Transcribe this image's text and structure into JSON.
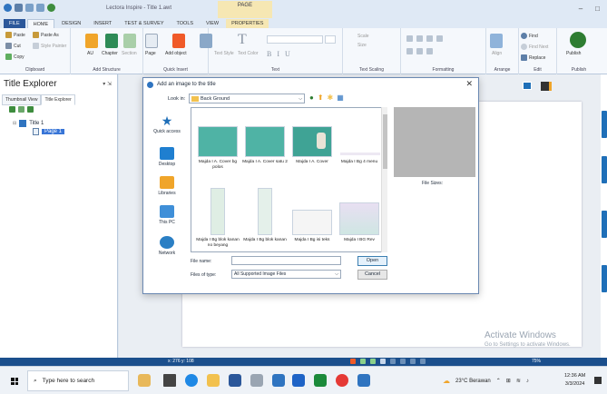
{
  "window": {
    "title": "Lectora Inspire - Title 1.awt",
    "context_tab_group": "PAGE",
    "controls": [
      "–",
      "□"
    ]
  },
  "tabs": [
    "FILE",
    "HOME",
    "DESIGN",
    "INSERT",
    "TEST & SURVEY",
    "TOOLS",
    "VIEW",
    "PROPERTIES"
  ],
  "ribbon": {
    "clipboard": {
      "paste": "Paste",
      "paste_as": "Paste As",
      "cut": "Cut",
      "style_painter": "Style Painter",
      "copy": "Copy",
      "label": "Clipboard"
    },
    "add_structure": {
      "au": "AU",
      "chapter": "Chapter",
      "section": "Section",
      "page": "Page",
      "label": "Add Structure"
    },
    "quick_insert": {
      "add_object": "Add object",
      "text_style": "Text Style",
      "text_color": "Text Color",
      "label": "Quick Insert"
    },
    "text": {
      "label": "Text",
      "bold": "B",
      "italic": "I",
      "underline": "U"
    },
    "text_scaling": {
      "scale": "Scale",
      "size": "Size",
      "label": "Text Scaling"
    },
    "formatting": {
      "label": "Formatting"
    },
    "arrange": {
      "align": "Align",
      "label": "Arrange"
    },
    "edit": {
      "find": "Find",
      "find_next": "Find Next",
      "replace": "Replace",
      "label": "Edit"
    },
    "publish": {
      "publish": "Publish",
      "label": "Publish"
    }
  },
  "left_panel": {
    "title": "Title Explorer",
    "pin": "▾ ⇲",
    "tabs": [
      "Thumbnail View",
      "Title Explorer"
    ],
    "tree": [
      {
        "label": "Title 1"
      },
      {
        "label": "Page 1"
      }
    ]
  },
  "dialog": {
    "title": "Add an image to the title",
    "close": "✕",
    "look_in_label": "Look in:",
    "look_in_value": "Back Ground",
    "places": [
      "Quick access",
      "Desktop",
      "Libraries",
      "This PC",
      "Network"
    ],
    "files": [
      {
        "name": "Majda I A. Cover bg polos",
        "thumb": "#4fb3a5"
      },
      {
        "name": "Majda I A. Cover satu 2",
        "thumb": "#4fb3a5"
      },
      {
        "name": "Majda I A. Cover",
        "thumb": "#3fa395"
      },
      {
        "name": "Majda I Bg 4 menu",
        "thumb": "#ede8f3"
      },
      {
        "name": "Majda I Bg blok kanan no beyang",
        "thumb": "#dfeee4"
      },
      {
        "name": "Majda I Bg blok kanan",
        "thumb": "#e4f0ea"
      },
      {
        "name": "Majda I Bg isi teks",
        "thumb": "#f5f5f5"
      },
      {
        "name": "Majda I BG Rev",
        "thumb": "#d7e6ee"
      }
    ],
    "file_sizes_label": "File Sizes:",
    "file_name_label": "File name:",
    "file_name_value": "",
    "file_type_label": "Files of type:",
    "file_type_value": "All Supported Image Files",
    "open_button": "Open",
    "cancel_button": "Cancel"
  },
  "status_bar": {
    "coords": "x: 276 y: 108",
    "zoom": "75%"
  },
  "watermark": {
    "line1": "Activate Windows",
    "line2": "Go to Settings to activate Windows."
  },
  "taskbar": {
    "search_placeholder": "Type here to search",
    "weather": "23°C  Berawan",
    "tray_text": "ENG",
    "time": "12:36 AM",
    "date": "3/3/2024"
  },
  "colors": {
    "brand_blue": "#2b579a",
    "status_blue": "#1b4f8c",
    "selection": "#3875d7"
  }
}
